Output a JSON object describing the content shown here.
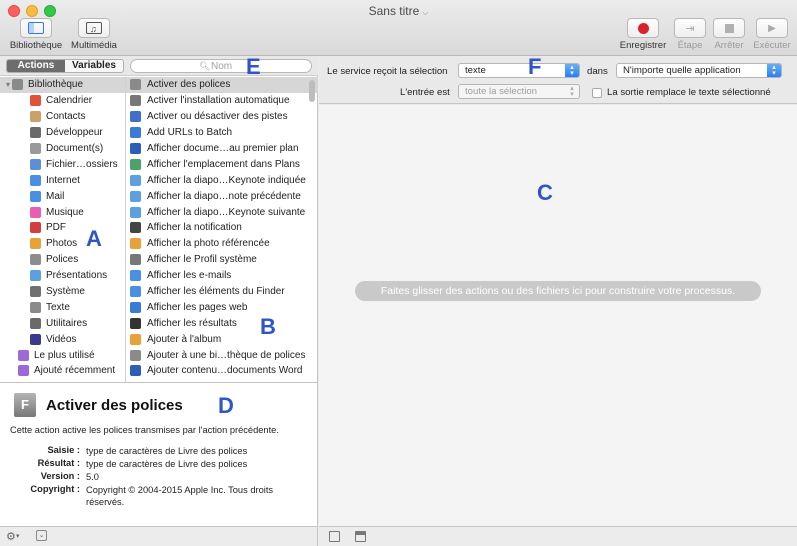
{
  "window": {
    "title": "Sans titre"
  },
  "toolbar": {
    "library": "Bibliothèque",
    "media": "Multimédia",
    "record": "Enregistrer",
    "step": "Étape",
    "stop": "Arrêter",
    "run": "Exécuter"
  },
  "tabs": {
    "actions": "Actions",
    "variables": "Variables"
  },
  "search": {
    "placeholder": "Nom"
  },
  "categories": [
    "Bibliothèque",
    "Calendrier",
    "Contacts",
    "Développeur",
    "Document(s)",
    "Fichier…ossiers",
    "Internet",
    "Mail",
    "Musique",
    "PDF",
    "Photos",
    "Polices",
    "Présentations",
    "Système",
    "Texte",
    "Utilitaires",
    "Vidéos",
    "Le plus utilisé",
    "Ajouté récemment"
  ],
  "actions": [
    "Activer des polices",
    "Activer l'installation automatique",
    "Activer ou désactiver des pistes",
    "Add URLs to Batch",
    "Afficher docume…au premier plan",
    "Afficher l'emplacement dans Plans",
    "Afficher la diapo…Keynote indiquée",
    "Afficher la diapo…note précédente",
    "Afficher la diapo…Keynote suivante",
    "Afficher la notification",
    "Afficher la photo référencée",
    "Afficher le Profil système",
    "Afficher les e-mails",
    "Afficher les éléments du Finder",
    "Afficher les pages web",
    "Afficher les résultats",
    "Ajouter à l'album",
    "Ajouter à une bi…thèque de polices",
    "Ajouter contenu…documents Word"
  ],
  "description": {
    "title": "Activer des polices",
    "text": "Cette action active les polices transmises par l'action précédente.",
    "input_label": "Saisie :",
    "input_value": "type de caractères de Livre des polices",
    "result_label": "Résultat :",
    "result_value": "type de caractères de Livre des polices",
    "version_label": "Version :",
    "version_value": "5.0",
    "copyright_label": "Copyright :",
    "copyright_value": "Copyright © 2004-2015 Apple Inc. Tous droits réservés."
  },
  "service": {
    "receives_label": "Le service reçoit la sélection",
    "receives_value": "texte",
    "in_label": "dans",
    "app_value": "N'importe quelle application",
    "input_label": "L'entrée est",
    "input_value": "toute la sélection",
    "replace_label": "La sortie remplace le texte sélectionné"
  },
  "workflow": {
    "hint": "Faites glisser des actions ou des fichiers ici pour construire votre processus."
  },
  "overlays": {
    "a": "A",
    "b": "B",
    "c": "C",
    "d": "D",
    "e": "E",
    "f": "F"
  },
  "icon_colors": [
    "#8a8a8a",
    "#e0533b",
    "#c9a26a",
    "#6a6a6a",
    "#9a9a9a",
    "#5b8fd6",
    "#4a8fe0",
    "#4a8fe0",
    "#e85fb2",
    "#d04040",
    "#e8a23a",
    "#8d8d8d",
    "#5da0e0",
    "#707070",
    "#8a8a8a",
    "#6a6a6a",
    "#3a3a8a",
    "#9b6ad6",
    "#9b6ad6"
  ]
}
